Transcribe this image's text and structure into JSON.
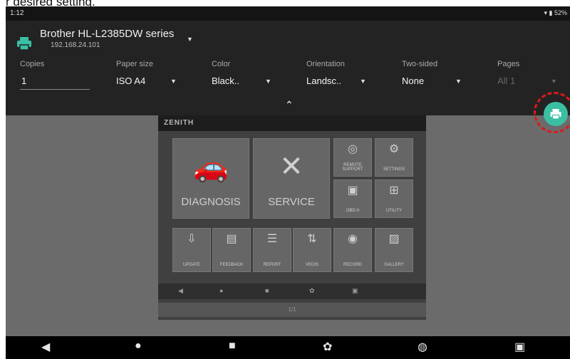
{
  "caption": "r desired setting.",
  "status_bar": {
    "time": "1:12",
    "battery": "52%"
  },
  "printer": {
    "name": "Brother HL-L2385DW series",
    "ip": "192.168.24.101"
  },
  "options": {
    "copies": {
      "label": "Copies",
      "value": "1"
    },
    "paper_size": {
      "label": "Paper size",
      "value": "ISO A4"
    },
    "color": {
      "label": "Color",
      "value": "Black.."
    },
    "orientation": {
      "label": "Orientation",
      "value": "Landsc.."
    },
    "two_sided": {
      "label": "Two-sided",
      "value": "None"
    },
    "pages": {
      "label": "Pages",
      "value": "All 1"
    }
  },
  "preview": {
    "logo": "ZENITH",
    "tiles": {
      "diagnosis": "DIAGNOSIS",
      "service": "SERVICE",
      "remote": "REMOTE SUPPORT",
      "settings": "SETTINGS",
      "obdii": "OBD-II",
      "utility": "UTILITY",
      "update": "UPDATE",
      "feedback": "FEEDBACK",
      "report": "REPORT",
      "vedis": "VEDIS",
      "record": "RECORD",
      "gallery": "GALLERY"
    },
    "page_footer": "1/1"
  },
  "colors": {
    "accent": "#3bbfa3",
    "highlight_ring": "#e01818",
    "panel": "#232323",
    "backdrop": "#6b6b6b"
  },
  "icons": {
    "printer": "printer-icon",
    "fab": "print-icon",
    "nav": [
      "back-icon",
      "home-icon",
      "recents-icon",
      "settings-icon",
      "chrome-icon",
      "screenshot-icon"
    ]
  }
}
